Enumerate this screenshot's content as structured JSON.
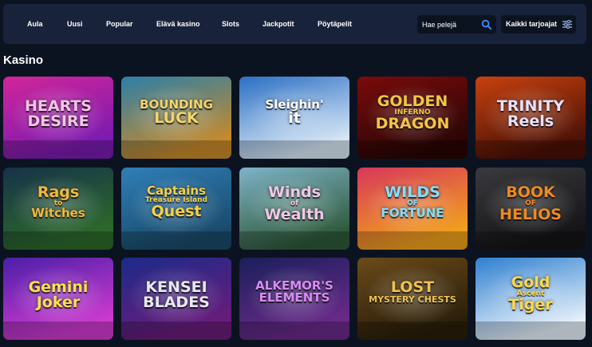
{
  "nav": {
    "items": [
      {
        "label": "Aula"
      },
      {
        "label": "Uusi"
      },
      {
        "label": "Popular"
      },
      {
        "label": "Elävä kasino"
      },
      {
        "label": "Slots"
      },
      {
        "label": "Jackpotit"
      },
      {
        "label": "Pöytäpelit"
      }
    ],
    "search_placeholder": "Hae pelejä",
    "filter_label": "Kaikki tarjoajat"
  },
  "section": {
    "title": "Kasino"
  },
  "games": [
    {
      "l1": "HEARTS",
      "l2": "DESIRE",
      "l3": "",
      "colors": [
        "#d2259a",
        "#7a1bb0"
      ],
      "text": "#f4c4e6"
    },
    {
      "l1": "BOUNDING",
      "l2": "LUCK",
      "l3": "",
      "colors": [
        "#2c7fa8",
        "#c88a2a"
      ],
      "text": "#f3d56a"
    },
    {
      "l1": "Sleighin'",
      "l2": "it",
      "l3": "",
      "colors": [
        "#2b6fc4",
        "#d9e8f6"
      ],
      "text": "#ffffff"
    },
    {
      "l1": "GOLDEN",
      "l2": "DRAGON",
      "l3": "INFERNO",
      "colors": [
        "#7a0b0b",
        "#2a0505"
      ],
      "text": "#f5c445"
    },
    {
      "l1": "TRINITY",
      "l2": "Reels",
      "l3": "",
      "colors": [
        "#c8410e",
        "#4a1006"
      ],
      "text": "#e9e1f8"
    },
    {
      "l1": "Rags",
      "l2": "Witches",
      "l3": "to",
      "colors": [
        "#16324a",
        "#2d6a2a"
      ],
      "text": "#f5b83a"
    },
    {
      "l1": "Captains",
      "l2": "Quest",
      "l3": "Treasure Island",
      "colors": [
        "#2f7fb8",
        "#1a4a6a"
      ],
      "text": "#f5d04a"
    },
    {
      "l1": "Winds",
      "l2": "Wealth",
      "l3": "of",
      "colors": [
        "#7fb3c8",
        "#2e5a3a"
      ],
      "text": "#f0c8e6"
    },
    {
      "l1": "WILDS",
      "l2": "FORTUNE",
      "l3": "OF",
      "colors": [
        "#d8375a",
        "#f0a21c"
      ],
      "text": "#7fe0ff"
    },
    {
      "l1": "BOOK",
      "l2": "HELIOS",
      "l3": "OF",
      "colors": [
        "#3a3a3e",
        "#141416"
      ],
      "text": "#f08a1c"
    },
    {
      "l1": "Gemini",
      "l2": "Joker",
      "l3": "",
      "colors": [
        "#4a1fa8",
        "#d03ad0"
      ],
      "text": "#f7e24a"
    },
    {
      "l1": "KENSEI",
      "l2": "BLADES",
      "l3": "",
      "colors": [
        "#1c2b8a",
        "#6a1c7a"
      ],
      "text": "#e8e8f0"
    },
    {
      "l1": "ALKEMOR'S",
      "l2": "ELEMENTS",
      "l3": "",
      "colors": [
        "#1a1f5a",
        "#6a2a8a"
      ],
      "text": "#d88af5"
    },
    {
      "l1": "LOST",
      "l2": "MYSTERY CHESTS",
      "l3": "",
      "colors": [
        "#6a4a1a",
        "#2a1e0a"
      ],
      "text": "#f0c24a"
    },
    {
      "l1": "Gold",
      "l2": "Tiger",
      "l3": "Ascent",
      "colors": [
        "#2f7fd0",
        "#e8f2fb"
      ],
      "text": "#ffd84a"
    }
  ]
}
